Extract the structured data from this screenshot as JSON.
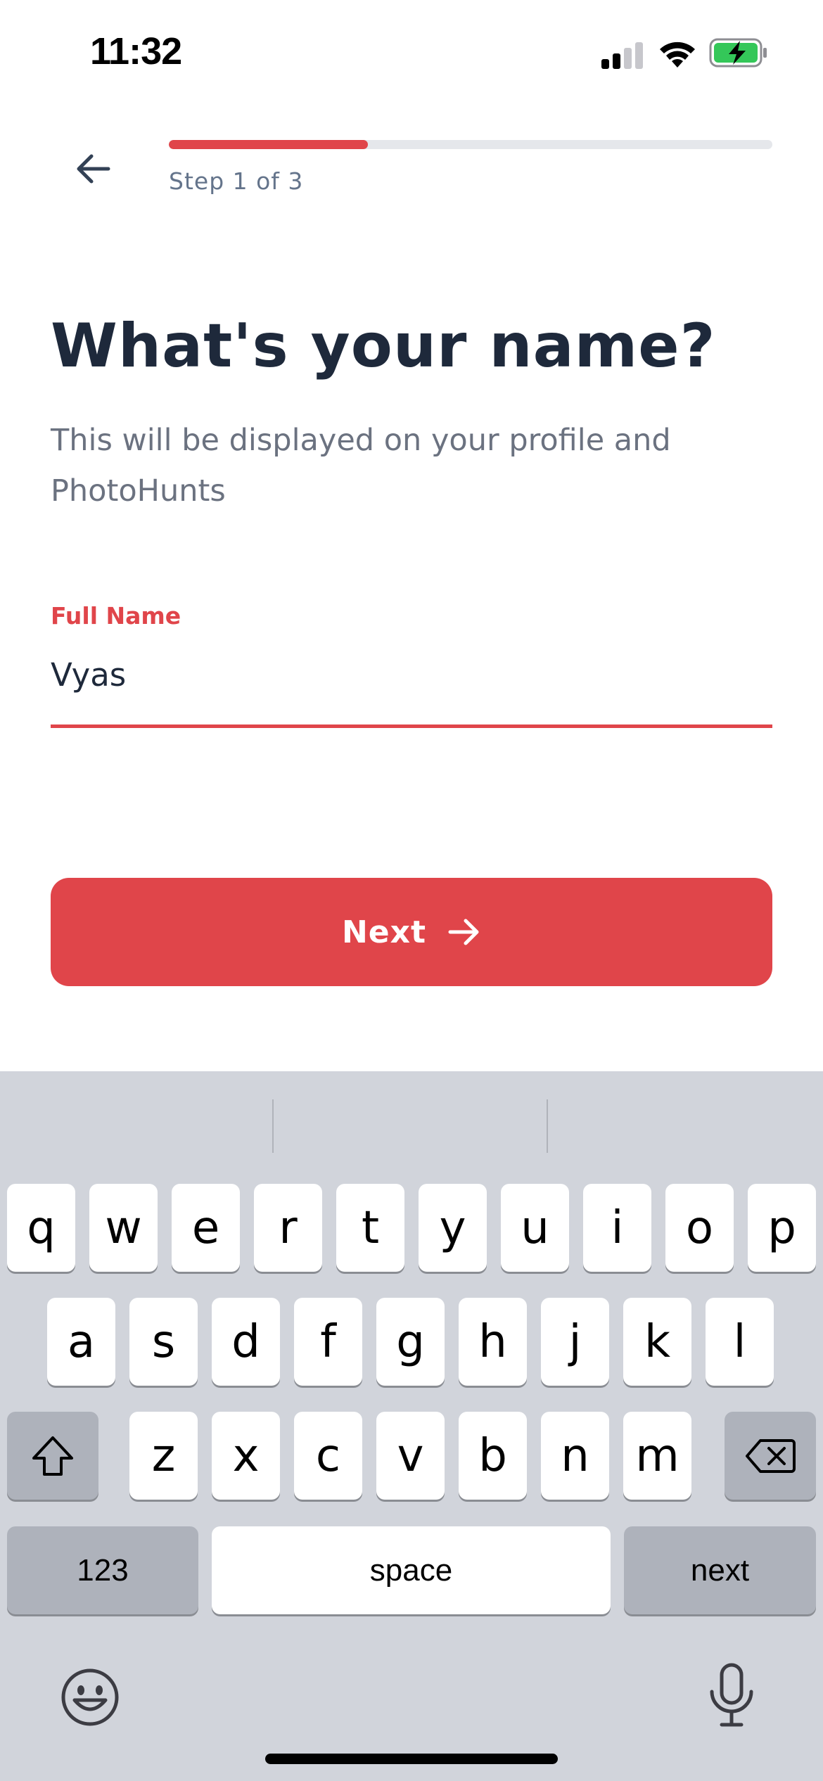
{
  "status_bar": {
    "time": "11:32"
  },
  "header": {
    "step_label": "Step 1 of 3",
    "progress": 0.33
  },
  "main": {
    "title": "What's your name?",
    "subtitle": "This will be displayed on your profile and PhotoHunts"
  },
  "form": {
    "label": "Full Name",
    "value": "Vyas"
  },
  "actions": {
    "next_label": "Next"
  },
  "keyboard": {
    "row1": [
      "q",
      "w",
      "e",
      "r",
      "t",
      "y",
      "u",
      "i",
      "o",
      "p"
    ],
    "row2": [
      "a",
      "s",
      "d",
      "f",
      "g",
      "h",
      "j",
      "k",
      "l"
    ],
    "row3": [
      "z",
      "x",
      "c",
      "v",
      "b",
      "n",
      "m"
    ],
    "numbers_label": "123",
    "space_label": "space",
    "return_label": "next"
  },
  "colors": {
    "accent": "#e0454a",
    "text": "#1e293b",
    "muted": "#6b7280",
    "keyboard_bg": "#d1d4db"
  }
}
